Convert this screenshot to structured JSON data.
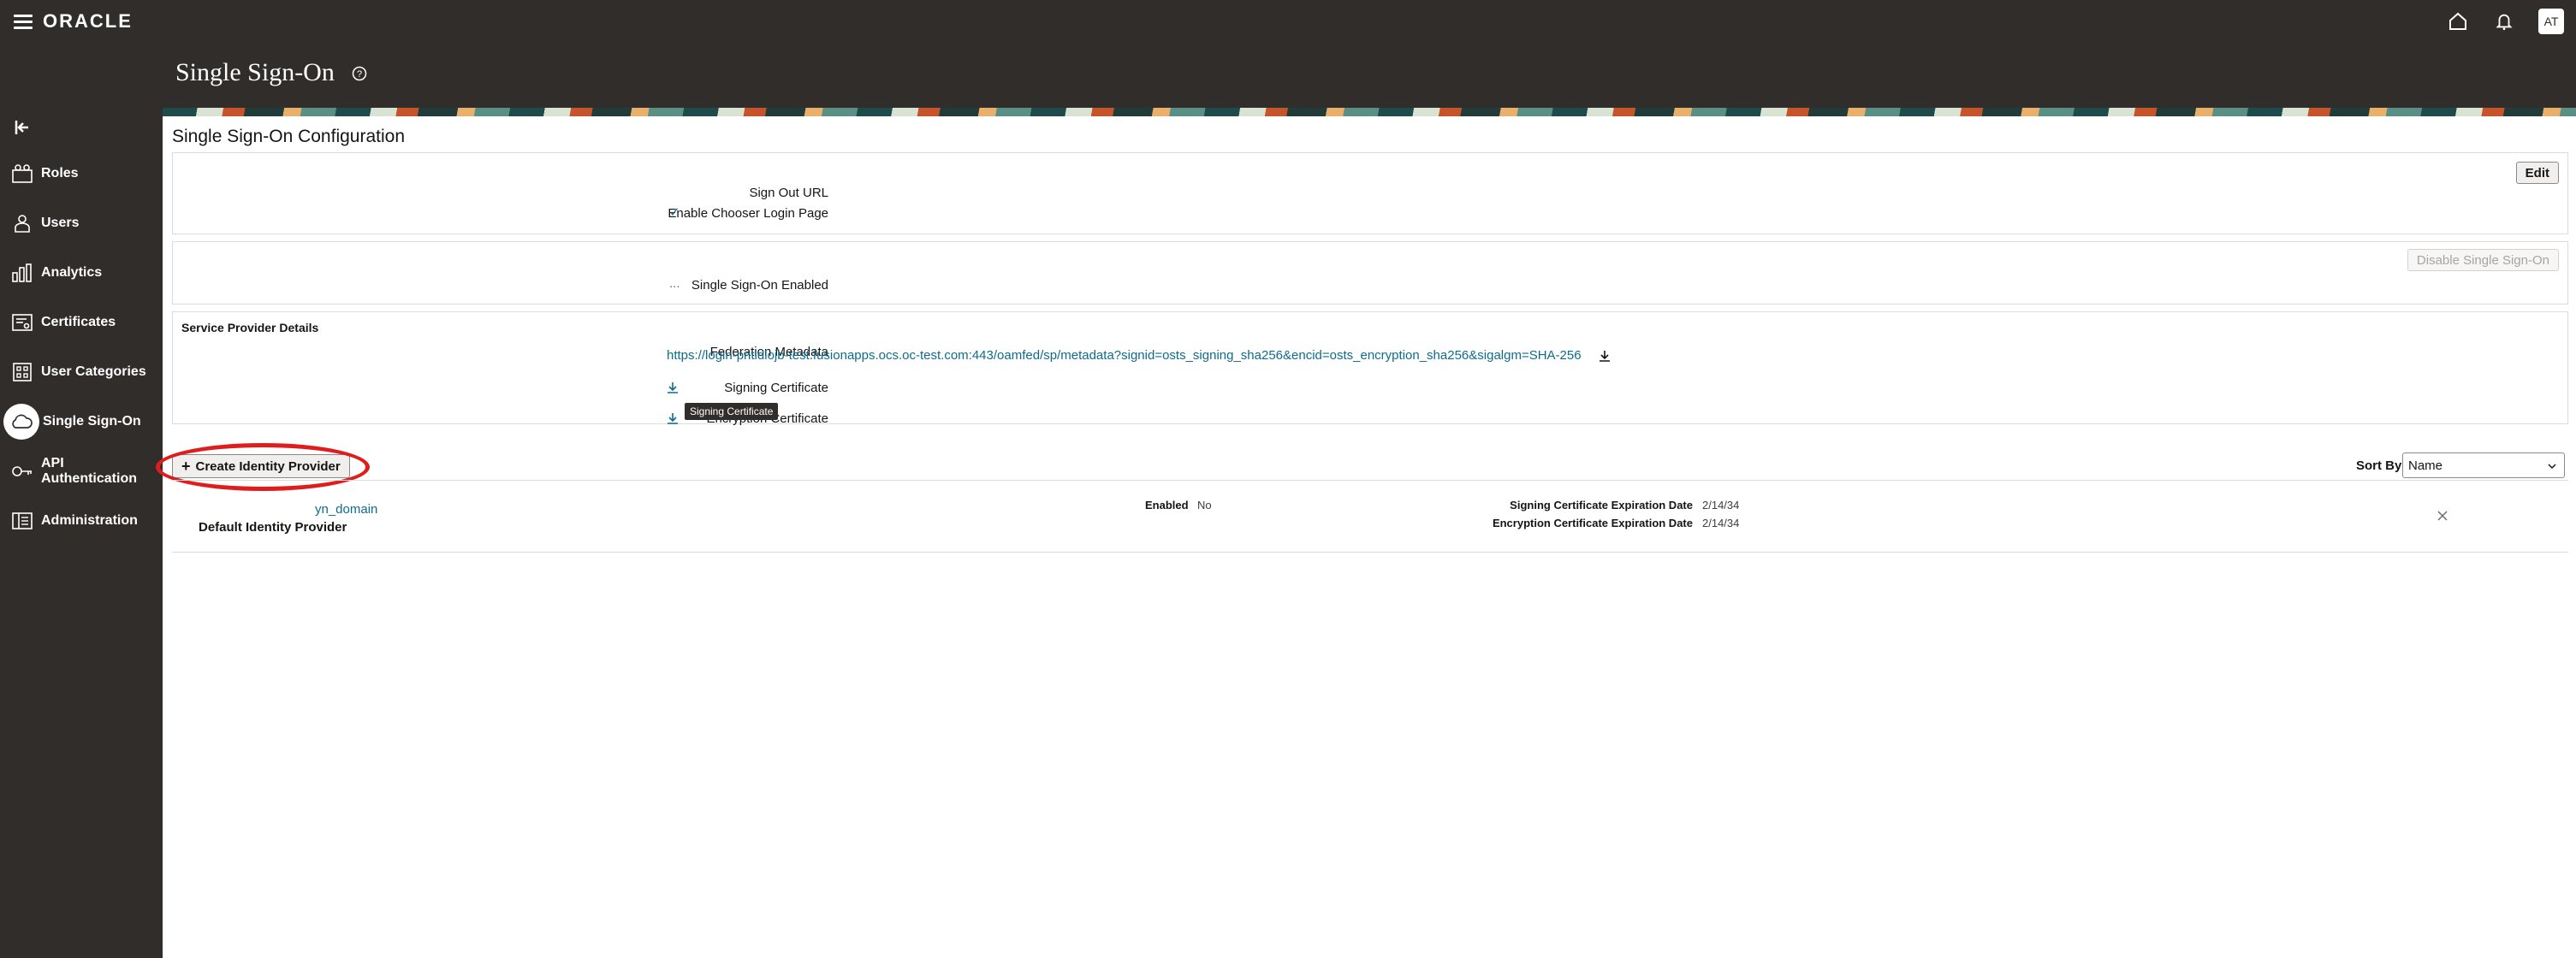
{
  "header": {
    "logo": "ORACLE",
    "page_title": "Single Sign-On",
    "avatar": "AT"
  },
  "sidebar": {
    "items": [
      {
        "label": "Roles",
        "icon": "roles-icon"
      },
      {
        "label": "Users",
        "icon": "users-icon"
      },
      {
        "label": "Analytics",
        "icon": "analytics-icon"
      },
      {
        "label": "Certificates",
        "icon": "certificates-icon"
      },
      {
        "label": "User Categories",
        "icon": "user-categories-icon"
      },
      {
        "label": "Single Sign-On",
        "icon": "cloud-icon",
        "active": true
      },
      {
        "label": "API Authentication",
        "icon": "key-icon"
      },
      {
        "label": "Administration",
        "icon": "administration-icon"
      }
    ]
  },
  "config": {
    "title": "Single Sign-On Configuration",
    "edit_label": "Edit",
    "sign_out_url_label": "Sign Out URL",
    "sign_out_url_value": "",
    "chooser_label": "Enable Chooser Login Page",
    "chooser_value": "✓",
    "disable_label": "Disable Single Sign-On",
    "sso_enabled_label": "Single Sign-On Enabled",
    "sso_enabled_value": "...",
    "sp_details_title": "Service Provider Details",
    "federation_metadata_label": "Federation Metadata",
    "federation_metadata_value": "https://login-pntidlojb-test.fusionapps.ocs.oc-test.com:443/oamfed/sp/metadata?signid=osts_signing_sha256&encid=osts_encryption_sha256&sigalgm=SHA-256",
    "signing_certificate_label": "Signing Certificate",
    "encryption_certificate_label": "Encryption Certificate",
    "tooltip": "Signing Certificate"
  },
  "identity_providers": {
    "create_label": "Create Identity Provider",
    "sort_by_label": "Sort By",
    "sort_by_value": "Name",
    "rows": [
      {
        "name": "yn_domain",
        "subtitle": "Default Identity Provider",
        "enabled_label": "Enabled",
        "enabled_value": "No",
        "signing_exp_label": "Signing Certificate Expiration Date",
        "signing_exp_value": "2/14/34",
        "encryption_exp_label": "Encryption Certificate Expiration Date",
        "encryption_exp_value": "2/14/34"
      }
    ]
  },
  "colors": {
    "topbar": "#312d2a",
    "link": "#0f6b8e",
    "highlight": "#e01d1d"
  }
}
